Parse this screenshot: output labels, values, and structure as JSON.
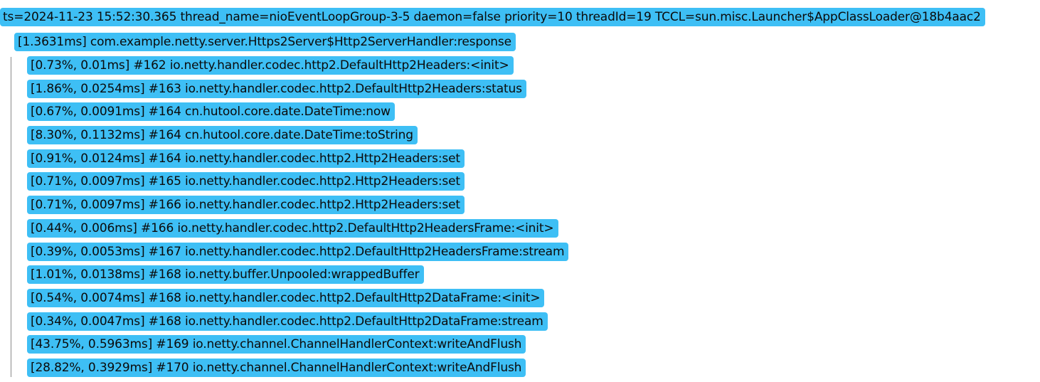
{
  "thread_header": "ts=2024-11-23 15:52:30.365 thread_name=nioEventLoopGroup-3-5 daemon=false priority=10 threadId=19 TCCL=sun.misc.Launcher$AppClassLoader@18b4aac2",
  "root_call": "[1.3631ms] com.example.netty.server.Https2Server$Http2ServerHandler:response",
  "highlight_color": "#3ebff5",
  "children": [
    {
      "label": "[0.73%, 0.01ms] #162 io.netty.handler.codec.http2.DefaultHttp2Headers:<init>"
    },
    {
      "label": "[1.86%, 0.0254ms] #163 io.netty.handler.codec.http2.DefaultHttp2Headers:status"
    },
    {
      "label": "[0.67%, 0.0091ms] #164 cn.hutool.core.date.DateTime:now"
    },
    {
      "label": "[8.30%, 0.1132ms] #164 cn.hutool.core.date.DateTime:toString"
    },
    {
      "label": "[0.91%, 0.0124ms] #164 io.netty.handler.codec.http2.Http2Headers:set"
    },
    {
      "label": "[0.71%, 0.0097ms] #165 io.netty.handler.codec.http2.Http2Headers:set"
    },
    {
      "label": "[0.71%, 0.0097ms] #166 io.netty.handler.codec.http2.Http2Headers:set"
    },
    {
      "label": "[0.44%, 0.006ms] #166 io.netty.handler.codec.http2.DefaultHttp2HeadersFrame:<init>"
    },
    {
      "label": "[0.39%, 0.0053ms] #167 io.netty.handler.codec.http2.DefaultHttp2HeadersFrame:stream"
    },
    {
      "label": "[1.01%, 0.0138ms] #168 io.netty.buffer.Unpooled:wrappedBuffer"
    },
    {
      "label": "[0.54%, 0.0074ms] #168 io.netty.handler.codec.http2.DefaultHttp2DataFrame:<init>"
    },
    {
      "label": "[0.34%, 0.0047ms] #168 io.netty.handler.codec.http2.DefaultHttp2DataFrame:stream"
    },
    {
      "label": "[43.75%, 0.5963ms] #169 io.netty.channel.ChannelHandlerContext:writeAndFlush"
    },
    {
      "label": "[28.82%, 0.3929ms] #170 io.netty.channel.ChannelHandlerContext:writeAndFlush"
    }
  ]
}
